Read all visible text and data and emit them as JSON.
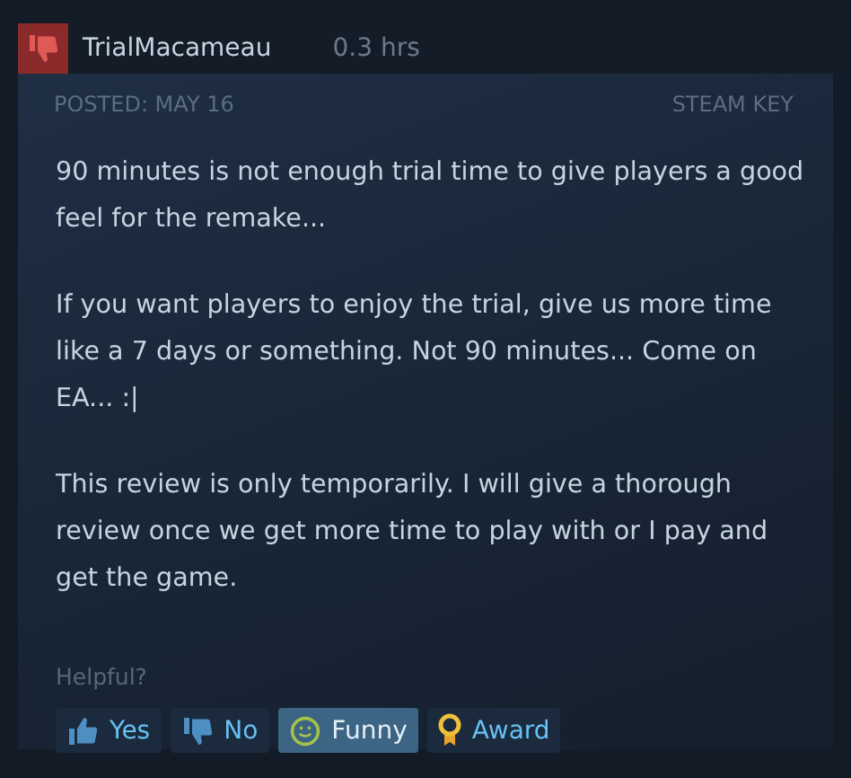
{
  "review": {
    "author": "TrialMacameau",
    "recommended": false,
    "hours": "0.3 hrs",
    "posted": "POSTED: MAY 16",
    "source": "STEAM KEY",
    "paragraphs": [
      "90 minutes is not enough trial time to give players a good feel for the remake...",
      "If you want players to enjoy the trial, give us more time like a 7 days or something. Not 90 minutes... Come on EA... :|",
      "This review is only temporarily. I will give a thorough review once we get more time to play with or I pay and get the game."
    ],
    "helpful_label": "Helpful?",
    "buttons": [
      {
        "kind": "yes",
        "label": "Yes",
        "selected": false
      },
      {
        "kind": "no",
        "label": "No",
        "selected": false
      },
      {
        "kind": "funny",
        "label": "Funny",
        "selected": true
      },
      {
        "kind": "award",
        "label": "Award",
        "selected": false
      }
    ]
  }
}
